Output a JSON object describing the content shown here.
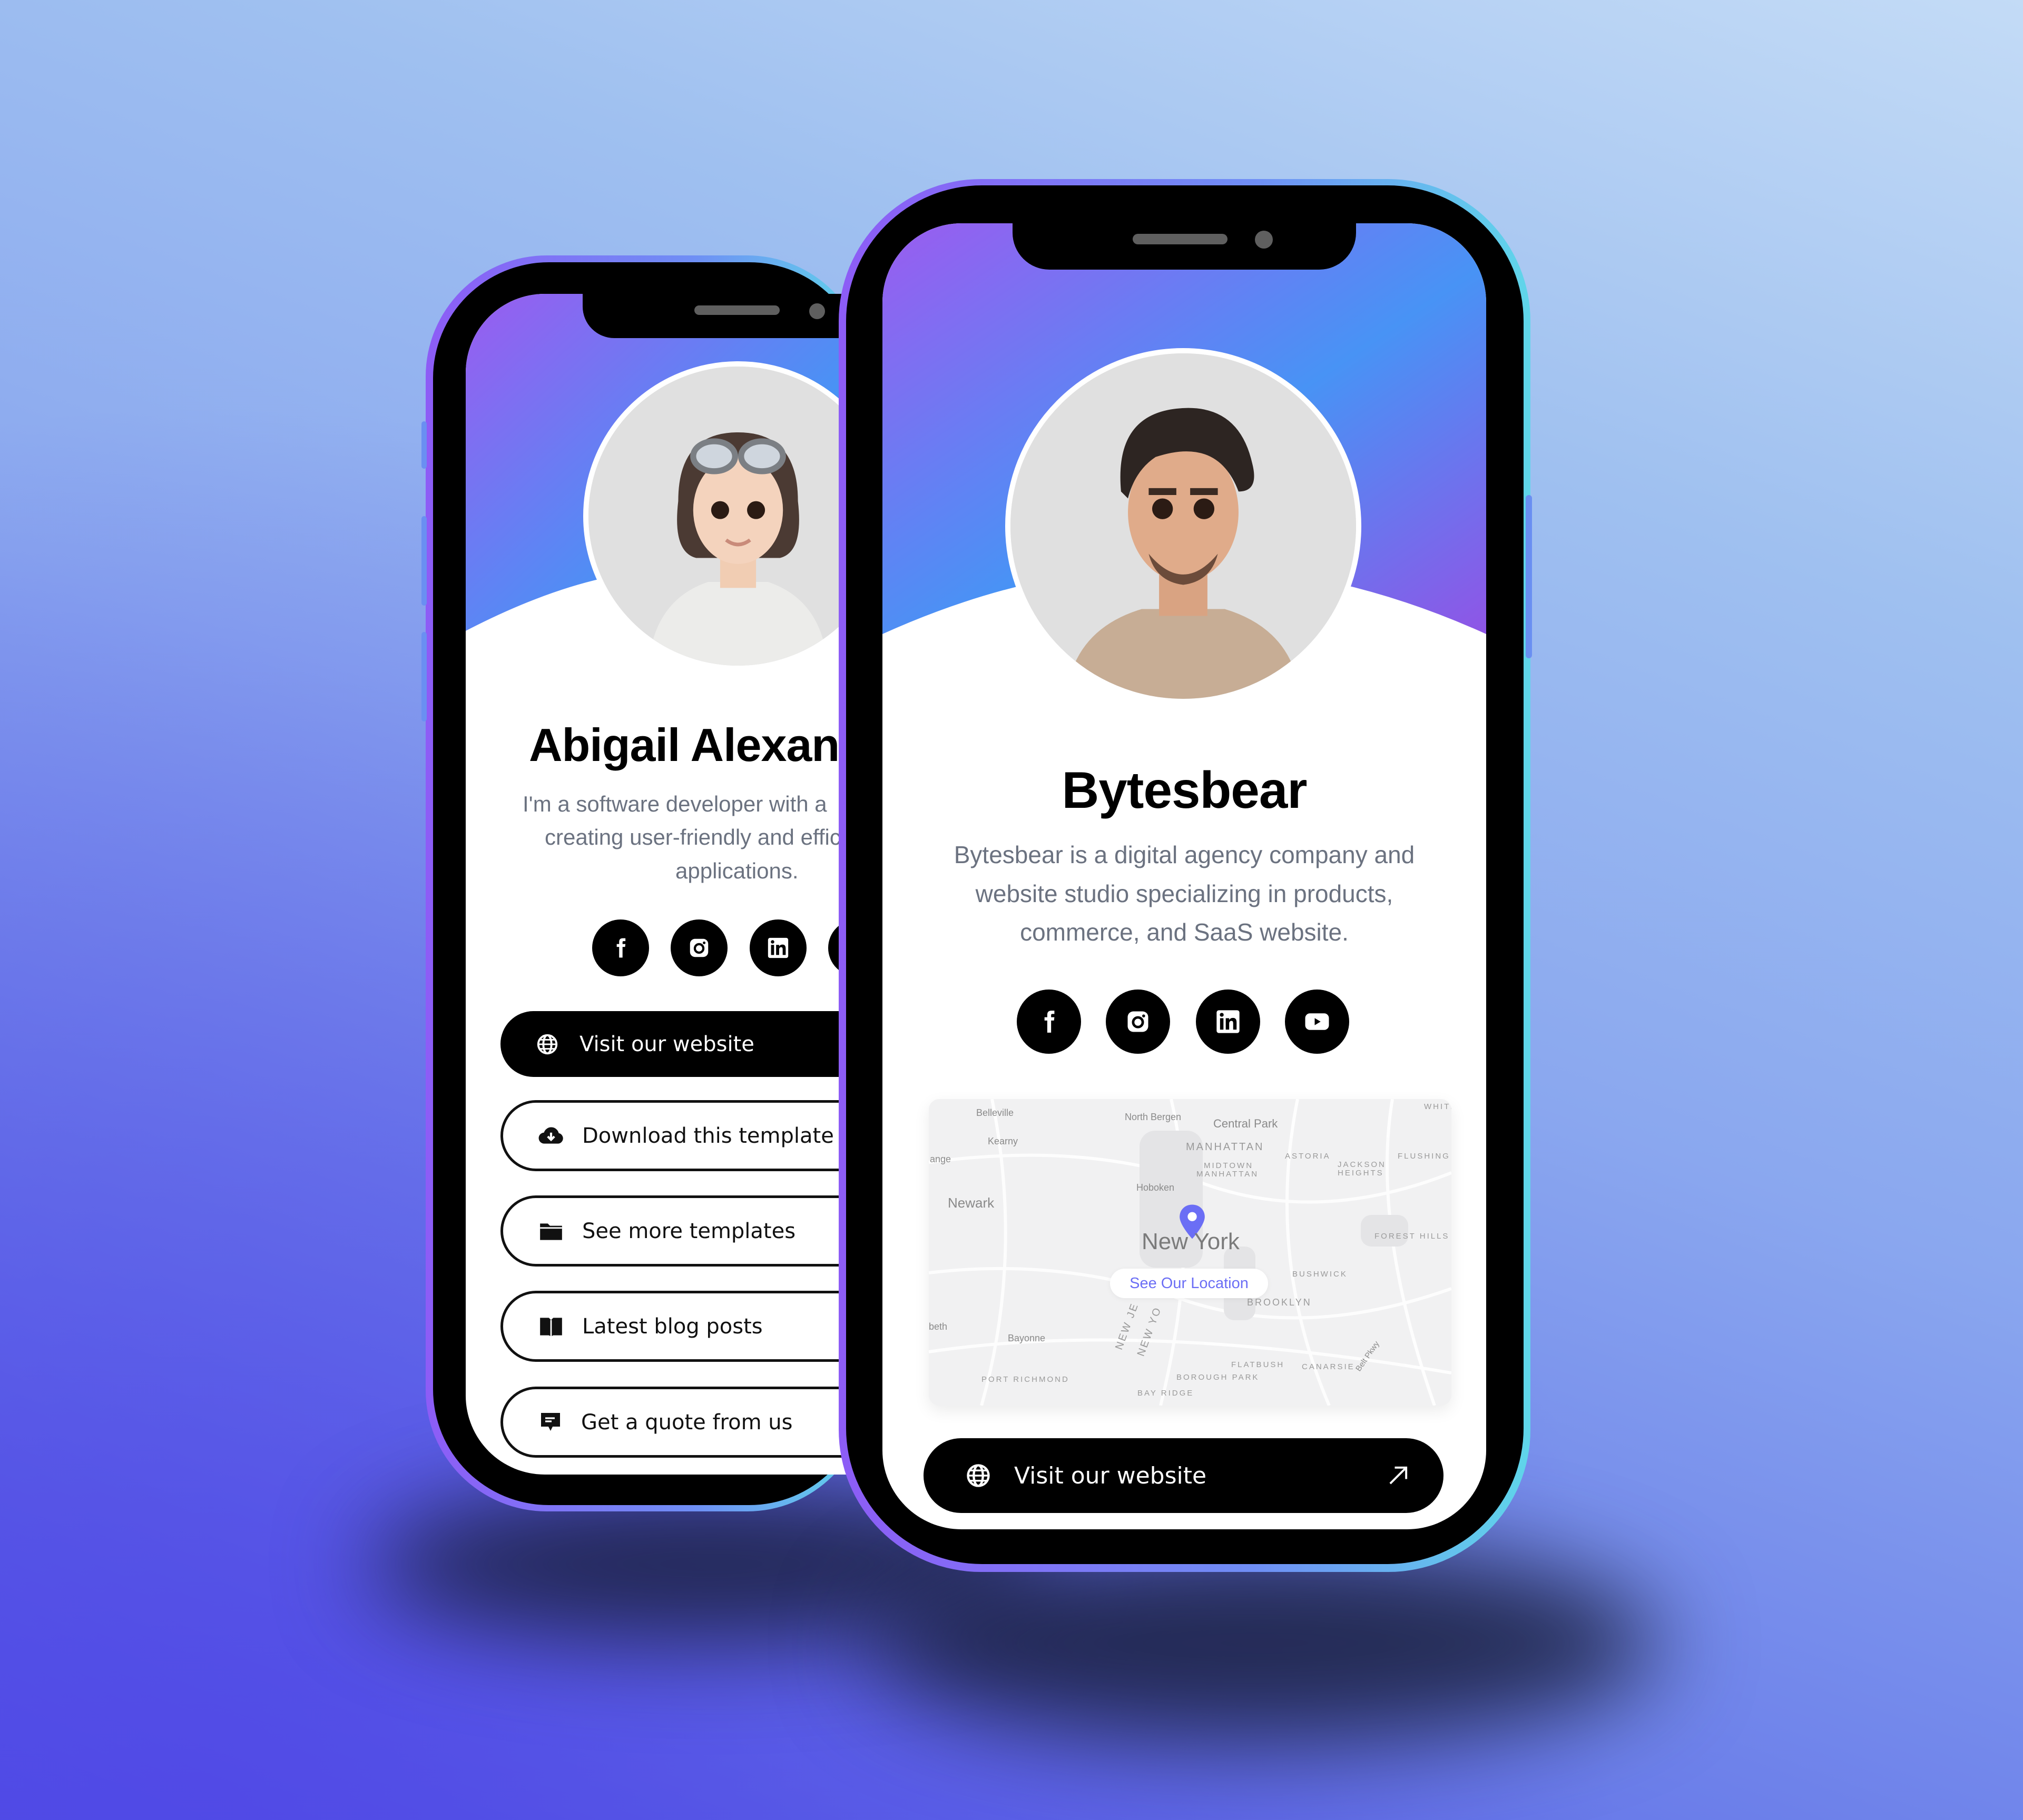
{
  "colors": {
    "hero_gradient_start": "#9a5cf0",
    "hero_gradient_end": "#4893f5",
    "bio_text": "#6b7280",
    "accent_link": "#6b6ef5",
    "map_pin": "#6b6ef5"
  },
  "back_phone": {
    "profile": {
      "name": "Abigail Alexander",
      "bio_lines": [
        "I'm a software developer with a",
        "creating user-friendly and effic",
        "applications."
      ]
    },
    "social_icons": [
      "facebook-icon",
      "instagram-icon",
      "linkedin-icon",
      "youtube-icon"
    ],
    "buttons": [
      {
        "label": "Visit our website",
        "icon": "globe-icon",
        "style": "dark"
      },
      {
        "label": "Download this template",
        "icon": "cloud-download-icon",
        "style": "outline"
      },
      {
        "label": "See more templates",
        "icon": "folder-icon",
        "style": "outline"
      },
      {
        "label": "Latest blog posts",
        "icon": "book-icon",
        "style": "outline"
      },
      {
        "label": "Get a quote from us",
        "icon": "chat-icon",
        "style": "outline"
      }
    ]
  },
  "front_phone": {
    "profile": {
      "name": "Bytesbear",
      "bio_lines": [
        "Bytesbear is a digital agency company and",
        "website studio specializing in products,",
        "commerce, and SaaS website."
      ]
    },
    "social_icons": [
      "facebook-icon",
      "instagram-icon",
      "linkedin-icon",
      "youtube-icon"
    ],
    "map": {
      "city": "New York",
      "cta": "See Our Location",
      "labels": {
        "belleville": "Belleville",
        "kearny": "Kearny",
        "orange": "ange",
        "newark": "Newark",
        "north_bergen": "North Bergen",
        "central_park": "Central Park",
        "manhattan": "MANHATTAN",
        "midtown1": "MIDTOWN",
        "midtown2": "MANHATTAN",
        "astoria": "ASTORIA",
        "jackson1": "JACKSON",
        "jackson2": "HEIGHTS",
        "flushing": "FLUSHING",
        "white": "WHITE",
        "hoboken": "Hoboken",
        "forest_hills": "FOREST HILLS",
        "bushwick": "BUSHWICK",
        "brooklyn": "BROOKLYN",
        "elizabeth": "beth",
        "bayonne": "Bayonne",
        "new_jersey": "NEW JE",
        "new_york_state": "NEW YO",
        "port_richmond": "PORT RICHMOND",
        "flatbush": "FLATBUSH",
        "borough_park": "BOROUGH PARK",
        "canarsie": "CANARSIE",
        "belt_pkwy": "Belt Pkwy",
        "bay_ridge": "BAY RIDGE"
      }
    },
    "cta_button": {
      "label": "Visit our website",
      "icon": "globe-icon",
      "trailing_icon": "arrow-up-right-icon"
    }
  }
}
